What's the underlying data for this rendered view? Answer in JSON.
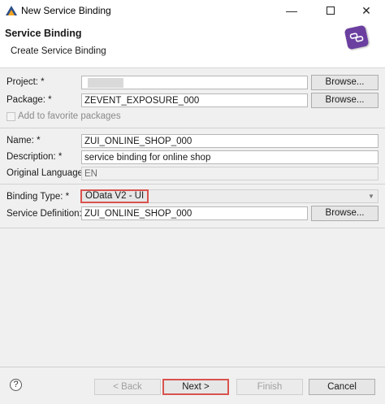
{
  "window": {
    "title": "New Service Binding",
    "min_symbol": "—",
    "close_symbol": "✕"
  },
  "header": {
    "title": "Service Binding",
    "subtitle": "Create Service Binding",
    "icon": "service-binding-icon"
  },
  "form": {
    "project": {
      "label": "Project: *",
      "value": "",
      "browse": "Browse..."
    },
    "package": {
      "label": "Package: *",
      "value": "ZEVENT_EXPOSURE_000",
      "browse": "Browse..."
    },
    "favorite": {
      "label": "Add to favorite packages",
      "checked": false
    },
    "name": {
      "label": "Name: *",
      "value": "ZUI_ONLINE_SHOP_000"
    },
    "description": {
      "label": "Description: *",
      "value": "service binding for online shop"
    },
    "original_language": {
      "label": "Original Language:",
      "value": "EN"
    },
    "binding_type": {
      "label": "Binding Type: *",
      "value": "OData V2 - UI"
    },
    "service_definition": {
      "label": "Service Definition: *",
      "value": "ZUI_ONLINE_SHOP_000",
      "browse": "Browse..."
    }
  },
  "footer": {
    "help": "?",
    "back": "< Back",
    "next": "Next >",
    "finish": "Finish",
    "cancel": "Cancel"
  },
  "colors": {
    "highlight": "#d9534f",
    "icon_bg": "#6b3fa0"
  }
}
